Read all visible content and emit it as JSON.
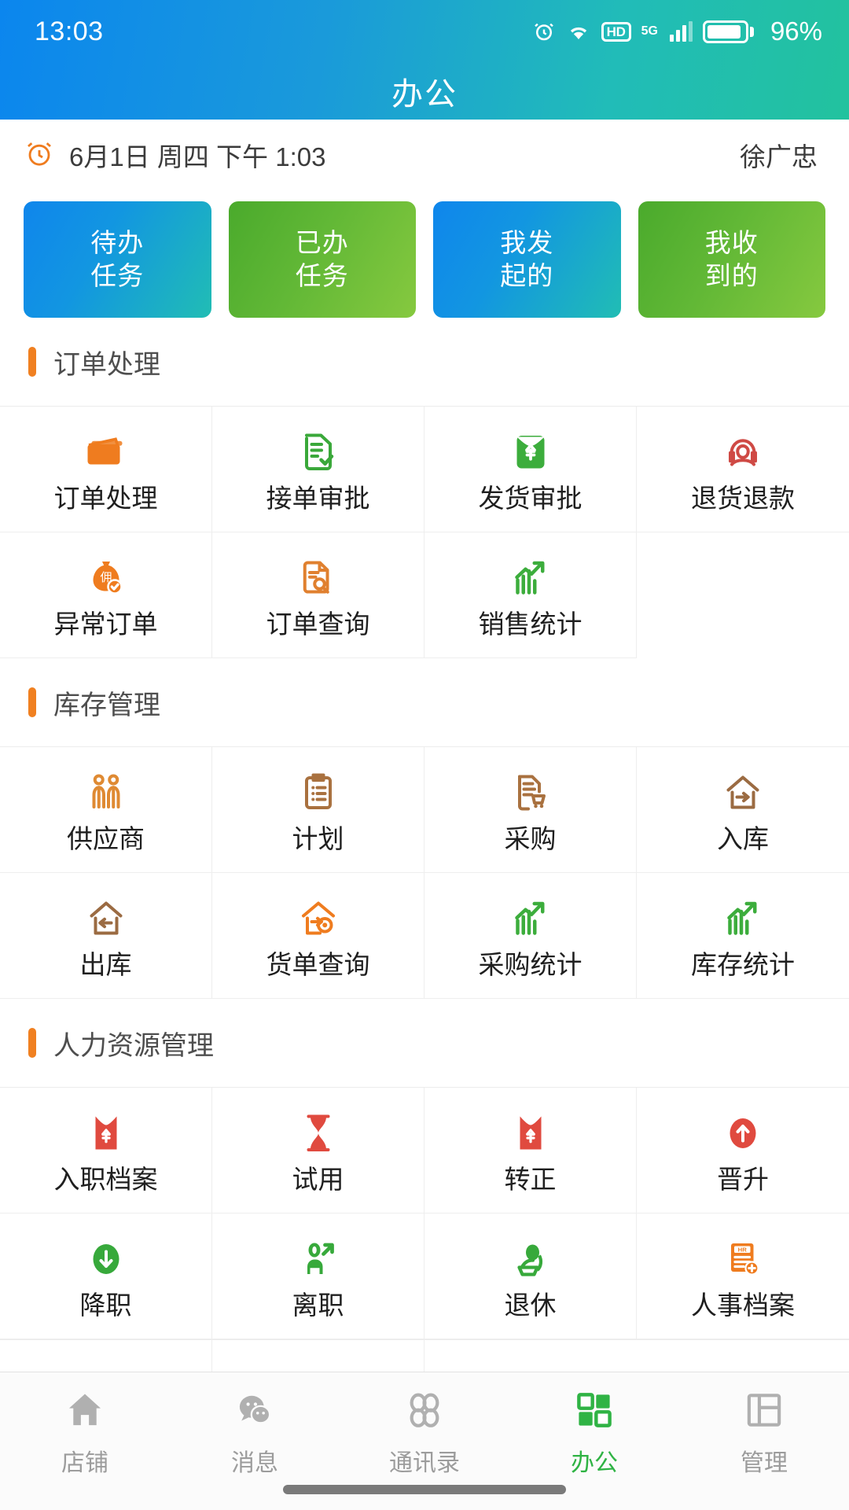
{
  "status": {
    "time": "13:03",
    "battery_percent": "96%",
    "network_type": "5G",
    "hd_badge": "HD",
    "icons": [
      "alarm-icon",
      "wifi-icon",
      "hd-icon",
      "signal-icon",
      "battery-icon"
    ]
  },
  "header": {
    "title": "办公"
  },
  "date_row": {
    "alarm_icon": "alarm-clock-icon",
    "datetime": "6月1日 周四 下午 1:03",
    "user": "徐广忠"
  },
  "quick_cards": [
    {
      "line1": "待办",
      "line2": "任务",
      "style": "blue"
    },
    {
      "line1": "已办",
      "line2": "任务",
      "style": "green"
    },
    {
      "line1": "我发",
      "line2": "起的",
      "style": "blue"
    },
    {
      "line1": "我收",
      "line2": "到的",
      "style": "green"
    }
  ],
  "sections": [
    {
      "title": "订单处理",
      "items": [
        {
          "label": "订单处理",
          "icon": "folder-icon",
          "color": "#ef7c1f"
        },
        {
          "label": "接单审批",
          "icon": "doc-check-icon",
          "color": "#3aa83a"
        },
        {
          "label": "发货审批",
          "icon": "money-envelope-icon",
          "color": "#3cad3c"
        },
        {
          "label": "退货退款",
          "icon": "service-agent-icon",
          "color": "#cf4a45"
        },
        {
          "label": "异常订单",
          "icon": "money-bag-check-icon",
          "color": "#ef7c1f"
        },
        {
          "label": "订单查询",
          "icon": "doc-search-icon",
          "color": "#e0802f"
        },
        {
          "label": "销售统计",
          "icon": "bar-chart-up-icon",
          "color": "#3cad3c"
        },
        {
          "label": "",
          "icon": "",
          "color": ""
        }
      ]
    },
    {
      "title": "库存管理",
      "items": [
        {
          "label": "供应商",
          "icon": "suppliers-icon",
          "color": "#df8a33"
        },
        {
          "label": "计划",
          "icon": "clipboard-icon",
          "color": "#a9713f"
        },
        {
          "label": "采购",
          "icon": "doc-cart-icon",
          "color": "#a9713f"
        },
        {
          "label": "入库",
          "icon": "warehouse-in-icon",
          "color": "#9b6b42"
        },
        {
          "label": "出库",
          "icon": "warehouse-out-icon",
          "color": "#9b6b42"
        },
        {
          "label": "货单查询",
          "icon": "shipment-search-icon",
          "color": "#ef7c1f"
        },
        {
          "label": "采购统计",
          "icon": "bar-chart-up-icon",
          "color": "#3cad3c"
        },
        {
          "label": "库存统计",
          "icon": "bar-chart-up-icon",
          "color": "#3cad3c"
        }
      ]
    },
    {
      "title": "人力资源管理",
      "items": [
        {
          "label": "入职档案",
          "icon": "red-envelope-yuan-icon",
          "color": "#e04a3f"
        },
        {
          "label": "试用",
          "icon": "hourglass-icon",
          "color": "#e04a3f"
        },
        {
          "label": "转正",
          "icon": "red-envelope-yuan-icon",
          "color": "#e04a3f"
        },
        {
          "label": "晋升",
          "icon": "arrow-up-circle-icon",
          "color": "#e04a3f"
        },
        {
          "label": "降职",
          "icon": "arrow-down-circle-icon",
          "color": "#37a93b"
        },
        {
          "label": "离职",
          "icon": "person-exit-icon",
          "color": "#37a93b"
        },
        {
          "label": "退休",
          "icon": "retire-icon",
          "color": "#37a93b"
        },
        {
          "label": "人事档案",
          "icon": "hr-file-add-icon",
          "color": "#ef7c1f"
        }
      ]
    },
    {
      "title": "",
      "partial": true,
      "items": [
        {
          "label": "",
          "icon": "money-bag-icon",
          "color": "#ef7c1f"
        },
        {
          "label": "",
          "icon": "salary-card-icon",
          "color": "#ef7c1f"
        },
        {
          "label": "",
          "icon": "",
          "color": ""
        },
        {
          "label": "",
          "icon": "",
          "color": ""
        }
      ]
    }
  ],
  "tabbar": [
    {
      "label": "店铺",
      "icon": "home-icon",
      "active": false
    },
    {
      "label": "消息",
      "icon": "chat-icon",
      "active": false
    },
    {
      "label": "通讯录",
      "icon": "contacts-icon",
      "active": false
    },
    {
      "label": "办公",
      "icon": "grid-icon",
      "active": true
    },
    {
      "label": "管理",
      "icon": "layout-icon",
      "active": false
    }
  ],
  "theme": {
    "accent_green": "#2fb344",
    "accent_orange": "#f08021",
    "header_gradient_from": "#0b86ee",
    "header_gradient_to": "#22c29e"
  }
}
